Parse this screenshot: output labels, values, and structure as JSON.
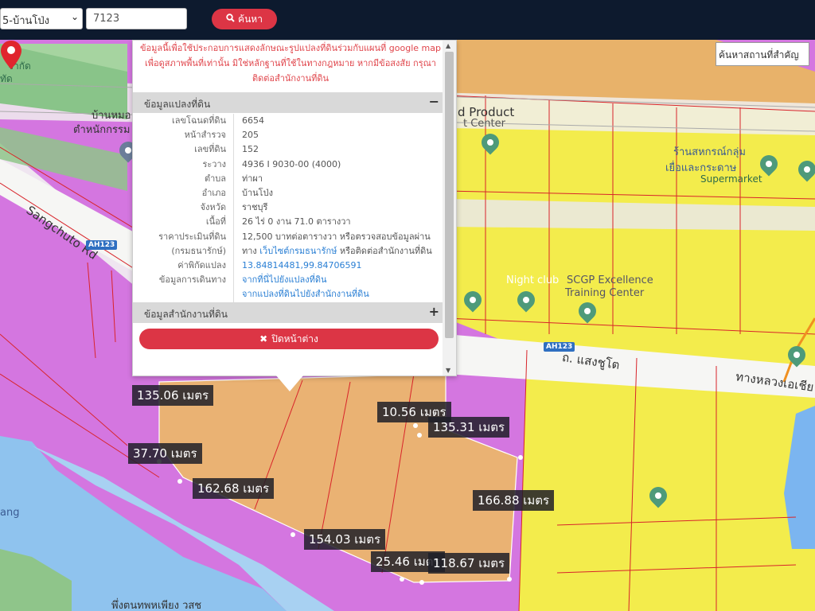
{
  "toolbar": {
    "district_value": "5-บ้านโป่ง",
    "parcel_value": "7123",
    "search_label": "ค้นหา"
  },
  "map": {
    "landmark_search_placeholder": "ค้นหาสถานที่สำคัญ",
    "labels": {
      "road_sangchuto": "Sangchuto Rd",
      "highway_shield_1": "AH123",
      "highway_shield_2": "AH123",
      "road_thai": "ถ. แสงชูโต",
      "road_thai_2": "ทางหลวงเอเชีย",
      "product_center": "d Product",
      "product_center_2": "t Center",
      "store_1": "ร้านสหกรณ์กลุ่ม",
      "store_2": "เยื่อและกระดาษ",
      "store_3": "Supermarket",
      "nightclub": "Night club",
      "scgp_1": "SCGP Excellence",
      "scgp_2": "Training Center",
      "left_1": "จำกัด",
      "left_2": "ทัด",
      "left_3": "บ้านหมอ",
      "left_4": "ตำหนักกรรม",
      "bottom_temple": "พึ่งตนทพหเพียง วสช",
      "river": "ang"
    },
    "measurements": [
      "135.06 เมตร",
      "10.56 เมตร",
      "135.31 เมตร",
      "37.70 เมตร",
      "162.68 เมตร",
      "166.88 เมตร",
      "154.03 เมตร",
      "25.46 เมตร",
      "118.67 เมตร"
    ]
  },
  "popup": {
    "notice": "ข้อมูลนี้เพื่อใช้ประกอบการแสดงลักษณะรูปแปลงที่ดินร่วมกับแผนที่ google map เพื่อดูสภาพพื้นที่เท่านั้น มิใช่หลักฐานที่ใช้ในทางกฎหมาย หากมีข้อสงสัย กรุณาติดต่อสำนักงานที่ดิน",
    "parcel_section_title": "ข้อมูลแปลงที่ดิน",
    "parcel_section_toggle": "−",
    "office_section_title": "ข้อมูลสำนักงานที่ดิน",
    "office_section_toggle": "+",
    "rows": [
      {
        "k": "เลขโฉนดที่ดิน",
        "v": "6654"
      },
      {
        "k": "หน้าสำรวจ",
        "v": "205"
      },
      {
        "k": "เลขที่ดิน",
        "v": "152"
      },
      {
        "k": "ระวาง",
        "v": "4936 I 9030-00 (4000)"
      },
      {
        "k": "ตำบล",
        "v": "ท่าผา"
      },
      {
        "k": "อำเภอ",
        "v": "บ้านโป่ง"
      },
      {
        "k": "จังหวัด",
        "v": "ราชบุรี"
      },
      {
        "k": "เนื้อที่",
        "v": "26 ไร่ 0 งาน 71.0 ตารางวา"
      },
      {
        "k": "ราคาประเมินที่ดิน",
        "v": "12,500 บาทต่อตารางวา หรือตรวจสอบข้อมูลผ่าน"
      },
      {
        "k": "(กรมธนารักษ์)",
        "v_prefix": "ทาง ",
        "v_link": "เว็บไซต์กรมธนารักษ์",
        "v_suffix": " หรือติดต่อสำนักงานที่ดิน"
      },
      {
        "k": "ค่าพิกัดแปลง",
        "v_link": "13.84814481,99.84706591"
      },
      {
        "k": "ข้อมูลการเดินทาง",
        "v_link": "จากที่นี่ไปยังแปลงที่ดิน"
      },
      {
        "k": "",
        "v_link": "จากแปลงที่ดินไปยังสำนักงานที่ดิน"
      }
    ],
    "close_label": "ปิดหน้าต่าง"
  }
}
